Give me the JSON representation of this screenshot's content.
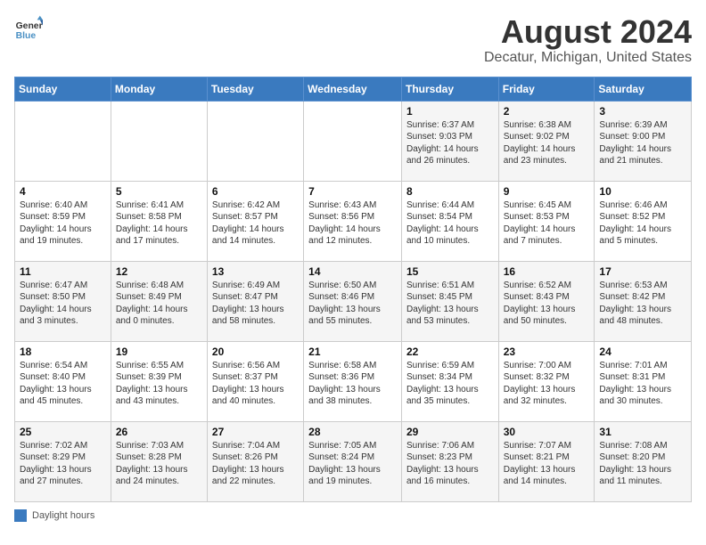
{
  "logo": {
    "line1": "General",
    "line2": "Blue"
  },
  "title": "August 2024",
  "location": "Decatur, Michigan, United States",
  "days_of_week": [
    "Sunday",
    "Monday",
    "Tuesday",
    "Wednesday",
    "Thursday",
    "Friday",
    "Saturday"
  ],
  "legend_label": "Daylight hours",
  "weeks": [
    [
      {
        "day": "",
        "info": ""
      },
      {
        "day": "",
        "info": ""
      },
      {
        "day": "",
        "info": ""
      },
      {
        "day": "",
        "info": ""
      },
      {
        "day": "1",
        "info": "Sunrise: 6:37 AM\nSunset: 9:03 PM\nDaylight: 14 hours and 26 minutes."
      },
      {
        "day": "2",
        "info": "Sunrise: 6:38 AM\nSunset: 9:02 PM\nDaylight: 14 hours and 23 minutes."
      },
      {
        "day": "3",
        "info": "Sunrise: 6:39 AM\nSunset: 9:00 PM\nDaylight: 14 hours and 21 minutes."
      }
    ],
    [
      {
        "day": "4",
        "info": "Sunrise: 6:40 AM\nSunset: 8:59 PM\nDaylight: 14 hours and 19 minutes."
      },
      {
        "day": "5",
        "info": "Sunrise: 6:41 AM\nSunset: 8:58 PM\nDaylight: 14 hours and 17 minutes."
      },
      {
        "day": "6",
        "info": "Sunrise: 6:42 AM\nSunset: 8:57 PM\nDaylight: 14 hours and 14 minutes."
      },
      {
        "day": "7",
        "info": "Sunrise: 6:43 AM\nSunset: 8:56 PM\nDaylight: 14 hours and 12 minutes."
      },
      {
        "day": "8",
        "info": "Sunrise: 6:44 AM\nSunset: 8:54 PM\nDaylight: 14 hours and 10 minutes."
      },
      {
        "day": "9",
        "info": "Sunrise: 6:45 AM\nSunset: 8:53 PM\nDaylight: 14 hours and 7 minutes."
      },
      {
        "day": "10",
        "info": "Sunrise: 6:46 AM\nSunset: 8:52 PM\nDaylight: 14 hours and 5 minutes."
      }
    ],
    [
      {
        "day": "11",
        "info": "Sunrise: 6:47 AM\nSunset: 8:50 PM\nDaylight: 14 hours and 3 minutes."
      },
      {
        "day": "12",
        "info": "Sunrise: 6:48 AM\nSunset: 8:49 PM\nDaylight: 14 hours and 0 minutes."
      },
      {
        "day": "13",
        "info": "Sunrise: 6:49 AM\nSunset: 8:47 PM\nDaylight: 13 hours and 58 minutes."
      },
      {
        "day": "14",
        "info": "Sunrise: 6:50 AM\nSunset: 8:46 PM\nDaylight: 13 hours and 55 minutes."
      },
      {
        "day": "15",
        "info": "Sunrise: 6:51 AM\nSunset: 8:45 PM\nDaylight: 13 hours and 53 minutes."
      },
      {
        "day": "16",
        "info": "Sunrise: 6:52 AM\nSunset: 8:43 PM\nDaylight: 13 hours and 50 minutes."
      },
      {
        "day": "17",
        "info": "Sunrise: 6:53 AM\nSunset: 8:42 PM\nDaylight: 13 hours and 48 minutes."
      }
    ],
    [
      {
        "day": "18",
        "info": "Sunrise: 6:54 AM\nSunset: 8:40 PM\nDaylight: 13 hours and 45 minutes."
      },
      {
        "day": "19",
        "info": "Sunrise: 6:55 AM\nSunset: 8:39 PM\nDaylight: 13 hours and 43 minutes."
      },
      {
        "day": "20",
        "info": "Sunrise: 6:56 AM\nSunset: 8:37 PM\nDaylight: 13 hours and 40 minutes."
      },
      {
        "day": "21",
        "info": "Sunrise: 6:58 AM\nSunset: 8:36 PM\nDaylight: 13 hours and 38 minutes."
      },
      {
        "day": "22",
        "info": "Sunrise: 6:59 AM\nSunset: 8:34 PM\nDaylight: 13 hours and 35 minutes."
      },
      {
        "day": "23",
        "info": "Sunrise: 7:00 AM\nSunset: 8:32 PM\nDaylight: 13 hours and 32 minutes."
      },
      {
        "day": "24",
        "info": "Sunrise: 7:01 AM\nSunset: 8:31 PM\nDaylight: 13 hours and 30 minutes."
      }
    ],
    [
      {
        "day": "25",
        "info": "Sunrise: 7:02 AM\nSunset: 8:29 PM\nDaylight: 13 hours and 27 minutes."
      },
      {
        "day": "26",
        "info": "Sunrise: 7:03 AM\nSunset: 8:28 PM\nDaylight: 13 hours and 24 minutes."
      },
      {
        "day": "27",
        "info": "Sunrise: 7:04 AM\nSunset: 8:26 PM\nDaylight: 13 hours and 22 minutes."
      },
      {
        "day": "28",
        "info": "Sunrise: 7:05 AM\nSunset: 8:24 PM\nDaylight: 13 hours and 19 minutes."
      },
      {
        "day": "29",
        "info": "Sunrise: 7:06 AM\nSunset: 8:23 PM\nDaylight: 13 hours and 16 minutes."
      },
      {
        "day": "30",
        "info": "Sunrise: 7:07 AM\nSunset: 8:21 PM\nDaylight: 13 hours and 14 minutes."
      },
      {
        "day": "31",
        "info": "Sunrise: 7:08 AM\nSunset: 8:20 PM\nDaylight: 13 hours and 11 minutes."
      }
    ]
  ]
}
